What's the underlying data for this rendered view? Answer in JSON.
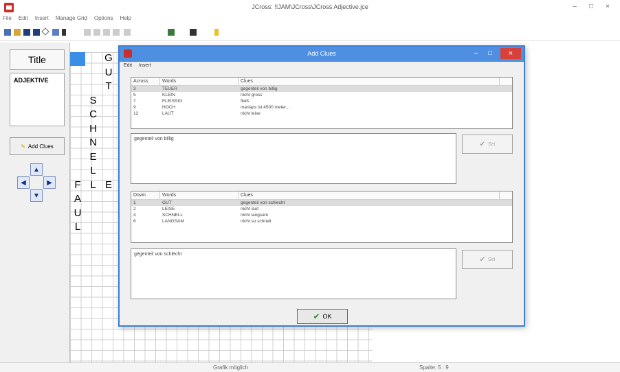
{
  "window": {
    "title": "JCross: !!JAM\\JCross\\JCross Adjective.jce",
    "min": "–",
    "max": "□",
    "close": "×"
  },
  "menubar": [
    "File",
    "Edit",
    "Insert",
    "Manage Grid",
    "Options",
    "Help"
  ],
  "left_panel": {
    "title_label": "Title",
    "puzzle_title": "ADJEKTIVE",
    "add_clues_label": "Add Clues",
    "arrows": {
      "up": "▲",
      "left": "◀",
      "right": "▶",
      "down": "▼"
    }
  },
  "grid": {
    "letters": [
      {
        "ch": "G",
        "col": 2,
        "row": 0
      },
      {
        "ch": "U",
        "col": 2,
        "row": 1
      },
      {
        "ch": "T",
        "col": 2,
        "row": 2
      },
      {
        "ch": "S",
        "col": 1,
        "row": 3
      },
      {
        "ch": "C",
        "col": 1,
        "row": 4
      },
      {
        "ch": "H",
        "col": 1,
        "row": 5
      },
      {
        "ch": "N",
        "col": 1,
        "row": 6
      },
      {
        "ch": "E",
        "col": 1,
        "row": 7
      },
      {
        "ch": "L",
        "col": 1,
        "row": 8
      },
      {
        "ch": "L",
        "col": 1,
        "row": 9
      },
      {
        "ch": "E",
        "col": 2,
        "row": 9
      },
      {
        "ch": "F",
        "col": 0,
        "row": 9
      },
      {
        "ch": "A",
        "col": 0,
        "row": 10
      },
      {
        "ch": "U",
        "col": 0,
        "row": 11
      },
      {
        "ch": "L",
        "col": 0,
        "row": 12
      }
    ]
  },
  "status": {
    "left": "Grafik möglich",
    "right": "Spalte: 5 : 9"
  },
  "dialog": {
    "title": "Add Clues",
    "minmax": "– □",
    "close": "×",
    "menu": [
      "Edit",
      "Insert"
    ],
    "across": {
      "headers": [
        "Across",
        "Words",
        "Clues"
      ],
      "rows": [
        {
          "num": "3",
          "word": "TEUER",
          "clue": "gegenteil von billig",
          "selected": true
        },
        {
          "num": "5",
          "word": "KLEIN",
          "clue": "nicht gross"
        },
        {
          "num": "7",
          "word": "FLEISSIG",
          "clue": "fleiß"
        },
        {
          "num": "9",
          "word": "HOCH",
          "clue": "mariaps ist 4500 meter..."
        },
        {
          "num": "12",
          "word": "LAUT",
          "clue": "nicht leise"
        }
      ],
      "edit_text": "gegenteil von billig",
      "set_label": "Set"
    },
    "down": {
      "headers": [
        "Down",
        "Words",
        "Clues"
      ],
      "rows": [
        {
          "num": "1",
          "word": "GUT",
          "clue": "gegenteil von schlecht",
          "selected": true
        },
        {
          "num": "2",
          "word": "LEISE",
          "clue": "nicht laut"
        },
        {
          "num": "4",
          "word": "SCHNELL",
          "clue": "nicht langsam"
        },
        {
          "num": "6",
          "word": "LANGSAM",
          "clue": "nicht so schnell"
        }
      ],
      "edit_text": "gegenteil von schlecht",
      "set_label": "Set"
    },
    "ok_label": "OK"
  }
}
